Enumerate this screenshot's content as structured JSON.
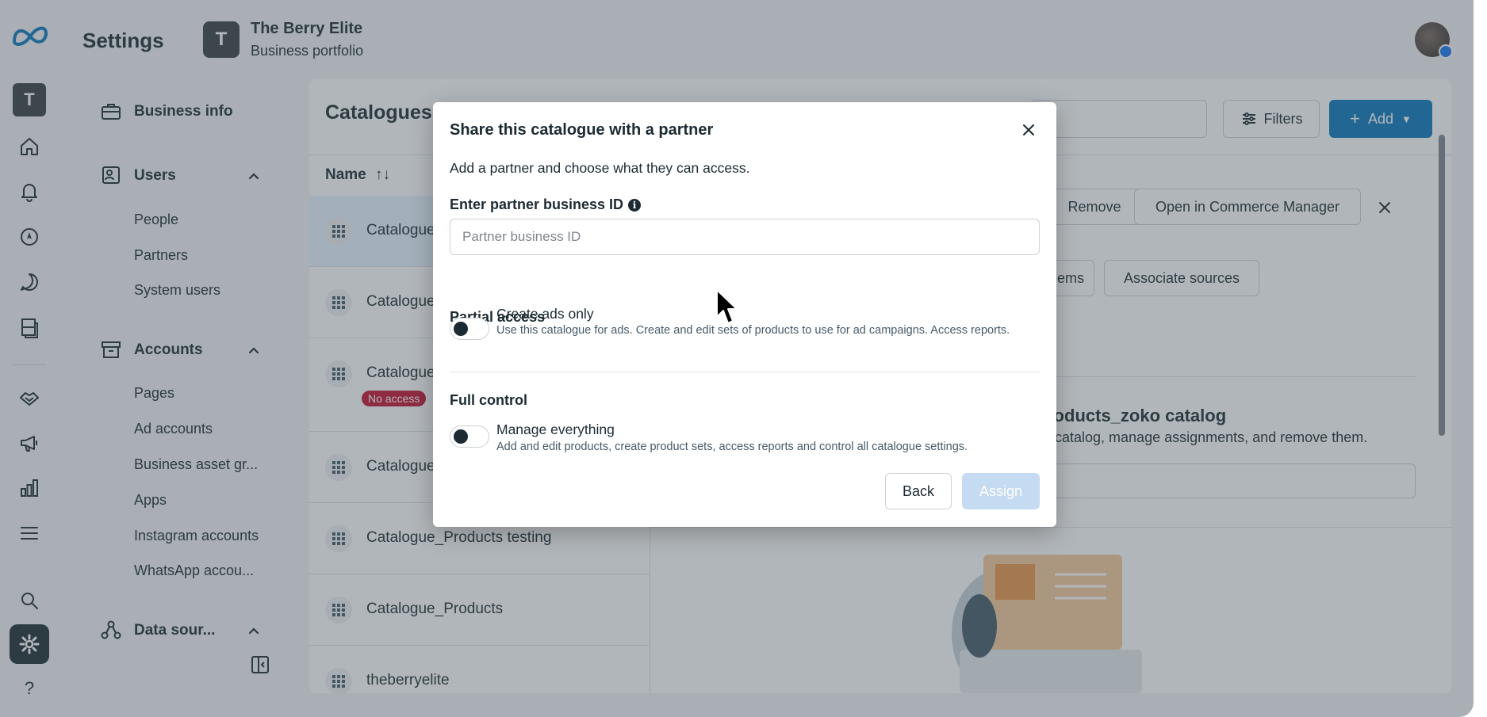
{
  "header": {
    "title": "Settings",
    "business_initial": "T",
    "business_name": "The Berry Elite",
    "business_subtitle": "Business portfolio"
  },
  "rail": {
    "workspace_initial": "T",
    "icons": [
      "meta-logo-icon",
      "home-icon",
      "bell-icon",
      "compass-icon",
      "chat-icon",
      "pages-icon",
      "handshake-icon",
      "megaphone-icon",
      "bar-chart-icon",
      "menu-icon",
      "search-icon",
      "gear-icon",
      "help-icon"
    ],
    "help_glyph": "?"
  },
  "sidebar": {
    "business_info": "Business info",
    "users": {
      "label": "Users",
      "items": [
        "People",
        "Partners",
        "System users"
      ]
    },
    "accounts": {
      "label": "Accounts",
      "items": [
        "Pages",
        "Ad accounts",
        "Business asset gr...",
        "Apps",
        "Instagram accounts",
        "WhatsApp accou..."
      ]
    },
    "data_sources": {
      "label": "Data sour..."
    }
  },
  "main": {
    "title": "Catalogues",
    "filters_label": "Filters",
    "add_label": "Add",
    "list_header": "Name",
    "sort_glyph": "↑↓",
    "rows": [
      {
        "label": "Catalogue"
      },
      {
        "label": "Catalogue"
      },
      {
        "label": "Catalogue",
        "badge": "No access"
      },
      {
        "label": "Catalogue"
      },
      {
        "label": "Catalogue_Products testing"
      },
      {
        "label": "Catalogue_Products"
      },
      {
        "label": "theberryelite"
      }
    ],
    "detail": {
      "remove_label": "Remove",
      "open_commerce_label": "Open in Commerce Manager",
      "items_label": "ems",
      "associate_label": "Associate sources",
      "title": "roducts_zoko catalog",
      "description": "catalog, manage assignments, and remove them."
    }
  },
  "modal": {
    "title": "Share this catalogue with a partner",
    "subtitle": "Add a partner and choose what they can access.",
    "id_label": "Enter partner business ID",
    "info_glyph": "i",
    "id_placeholder": "Partner business ID",
    "id_value": "",
    "partial_heading": "Partial access",
    "partial_option": {
      "title": "Create ads only",
      "description": "Use this catalogue for ads. Create and edit sets of products to use for ad campaigns. Access reports.",
      "enabled": false
    },
    "full_heading": "Full control",
    "full_option": {
      "title": "Manage everything",
      "description": "Add and edit products, create product sets, access reports and control all catalogue settings.",
      "enabled": false
    },
    "back_label": "Back",
    "assign_label": "Assign"
  },
  "colors": {
    "primary": "#0a78be",
    "assign_disabled": "#c5dbf2",
    "no_access_badge": "#c4112f",
    "text": "#1c2b33"
  }
}
